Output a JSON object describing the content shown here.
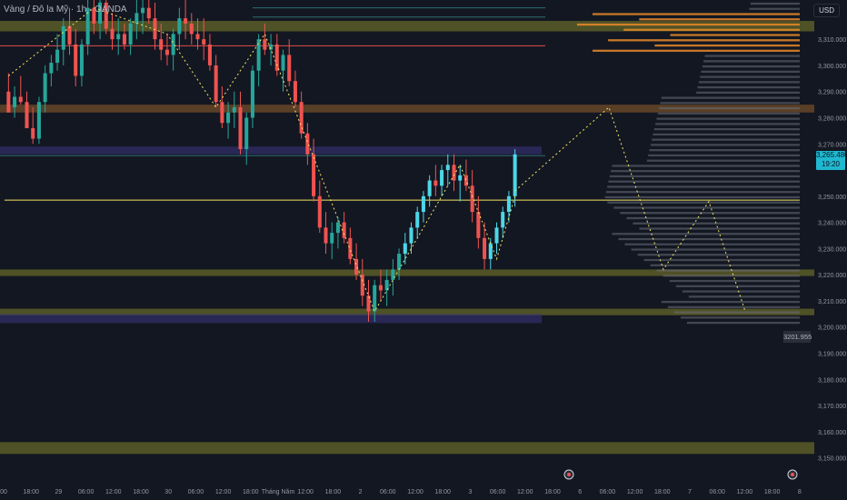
{
  "symbol_title": "Vàng / Đô la Mỹ · 1h · OANDA",
  "currency": "USD",
  "current_price": "3,265.480",
  "countdown": "19:20",
  "low_label": "3201.955",
  "y_axis_ticks": [
    "3,310.000",
    "3,300.000",
    "3,290.000",
    "3,280.000",
    "3,270.000",
    "3,250.000",
    "3,240.000",
    "3,230.000",
    "3,220.000",
    "3,210.000",
    "3,200.000",
    "3,190.000",
    "3,180.000",
    "3,170.000",
    "3,160.000",
    "3,150.000"
  ],
  "x_axis_ticks": [
    "00",
    "18:00",
    "29",
    "06:00",
    "12:00",
    "18:00",
    "30",
    "06:00",
    "12:00",
    "18:00",
    "Tháng Năm",
    "12:00",
    "18:00",
    "2",
    "06:00",
    "12:00",
    "18:00",
    "3",
    "06:00",
    "12:00",
    "18:00",
    "6",
    "06:00",
    "12:00",
    "18:00",
    "7",
    "06:00",
    "12:00",
    "18:00",
    "8"
  ],
  "colors": {
    "background": "#131722",
    "bull": "#26a69a",
    "bull_bright": "#4dd6e6",
    "bear": "#ef5350",
    "zone_olive": "#8b8b2a",
    "zone_brown": "#a0672a",
    "zone_purple": "#3a3580",
    "profile_orange": "#e8892a",
    "profile_grey": "#6b6f7a",
    "yellow_line": "#f5e663",
    "red_line": "#e04b4b"
  },
  "chart_data": {
    "type": "candlestick",
    "ylim": [
      3145,
      3325
    ],
    "hline_yellow": 3248.5,
    "hline_red": 3307.5,
    "hline_teal": [
      3318.5,
      3322,
      3265.5
    ],
    "zones": [
      {
        "color": "olive",
        "from": 3313,
        "to": 3317,
        "scope": "full"
      },
      {
        "color": "brown",
        "from": 3282,
        "to": 3285,
        "scope": "full"
      },
      {
        "color": "purple",
        "from": 3266,
        "to": 3269,
        "scope": "left"
      },
      {
        "color": "olive",
        "from": 3219.5,
        "to": 3222,
        "scope": "full"
      },
      {
        "color": "olive",
        "from": 3204.5,
        "to": 3207,
        "scope": "full"
      },
      {
        "color": "purple",
        "from": 3201.5,
        "to": 3205,
        "scope": "left"
      },
      {
        "color": "olive",
        "from": 3151.5,
        "to": 3156,
        "scope": "full"
      }
    ],
    "candles": [
      [
        3290,
        3297,
        3284,
        3282
      ],
      [
        3284,
        3292,
        3280,
        3288
      ],
      [
        3288,
        3296,
        3285,
        3286
      ],
      [
        3286,
        3290,
        3278,
        3276
      ],
      [
        3276,
        3284,
        3270,
        3272
      ],
      [
        3272,
        3288,
        3270,
        3286
      ],
      [
        3286,
        3300,
        3282,
        3297
      ],
      [
        3297,
        3304,
        3292,
        3301
      ],
      [
        3301,
        3312,
        3298,
        3306
      ],
      [
        3306,
        3318,
        3300,
        3315
      ],
      [
        3315,
        3322,
        3304,
        3308
      ],
      [
        3308,
        3314,
        3292,
        3296
      ],
      [
        3296,
        3310,
        3292,
        3308
      ],
      [
        3308,
        3325,
        3304,
        3322
      ],
      [
        3322,
        3325,
        3312,
        3316
      ],
      [
        3316,
        3325,
        3310,
        3324
      ],
      [
        3324,
        3325,
        3312,
        3314
      ],
      [
        3314,
        3320,
        3306,
        3310
      ],
      [
        3310,
        3318,
        3304,
        3312
      ],
      [
        3312,
        3316,
        3306,
        3308
      ],
      [
        3308,
        3318,
        3304,
        3316
      ],
      [
        3316,
        3325,
        3310,
        3320
      ],
      [
        3320,
        3325,
        3312,
        3322
      ],
      [
        3322,
        3325,
        3316,
        3318
      ],
      [
        3318,
        3324,
        3306,
        3310
      ],
      [
        3310,
        3316,
        3302,
        3306
      ],
      [
        3306,
        3312,
        3300,
        3304
      ],
      [
        3304,
        3314,
        3298,
        3312
      ],
      [
        3312,
        3322,
        3306,
        3318
      ],
      [
        3318,
        3325,
        3310,
        3316
      ],
      [
        3316,
        3320,
        3308,
        3312
      ],
      [
        3312,
        3318,
        3306,
        3310
      ],
      [
        3310,
        3318,
        3302,
        3308
      ],
      [
        3308,
        3312,
        3298,
        3300
      ],
      [
        3300,
        3304,
        3284,
        3286
      ],
      [
        3286,
        3292,
        3276,
        3278
      ],
      [
        3278,
        3286,
        3272,
        3282
      ],
      [
        3282,
        3290,
        3276,
        3284
      ],
      [
        3284,
        3290,
        3266,
        3268
      ],
      [
        3268,
        3282,
        3262,
        3280
      ],
      [
        3280,
        3300,
        3276,
        3298
      ],
      [
        3298,
        3312,
        3292,
        3310
      ],
      [
        3310,
        3316,
        3304,
        3306
      ],
      [
        3306,
        3312,
        3300,
        3308
      ],
      [
        3308,
        3312,
        3296,
        3298
      ],
      [
        3298,
        3306,
        3290,
        3304
      ],
      [
        3304,
        3310,
        3292,
        3294
      ],
      [
        3294,
        3298,
        3284,
        3286
      ],
      [
        3286,
        3290,
        3272,
        3274
      ],
      [
        3274,
        3278,
        3262,
        3266
      ],
      [
        3266,
        3272,
        3248,
        3250
      ],
      [
        3250,
        3256,
        3236,
        3238
      ],
      [
        3238,
        3244,
        3228,
        3232
      ],
      [
        3232,
        3240,
        3226,
        3236
      ],
      [
        3236,
        3242,
        3230,
        3240
      ],
      [
        3240,
        3244,
        3232,
        3234
      ],
      [
        3234,
        3238,
        3224,
        3226
      ],
      [
        3226,
        3232,
        3218,
        3220
      ],
      [
        3220,
        3226,
        3208,
        3212
      ],
      [
        3212,
        3218,
        3202,
        3206
      ],
      [
        3206,
        3218,
        3202,
        3216
      ],
      [
        3216,
        3222,
        3210,
        3214
      ],
      [
        3214,
        3222,
        3208,
        3218
      ],
      [
        3218,
        3226,
        3212,
        3222
      ],
      [
        3222,
        3230,
        3218,
        3228
      ],
      [
        3228,
        3236,
        3224,
        3232
      ],
      [
        3232,
        3240,
        3228,
        3238
      ],
      [
        3238,
        3246,
        3234,
        3244
      ],
      [
        3244,
        3252,
        3240,
        3250
      ],
      [
        3250,
        3258,
        3246,
        3256
      ],
      [
        3256,
        3262,
        3250,
        3254
      ],
      [
        3254,
        3262,
        3250,
        3260
      ],
      [
        3260,
        3266,
        3254,
        3262
      ],
      [
        3262,
        3266,
        3252,
        3256
      ],
      [
        3256,
        3262,
        3248,
        3258
      ],
      [
        3258,
        3264,
        3252,
        3254
      ],
      [
        3254,
        3260,
        3240,
        3244
      ],
      [
        3244,
        3250,
        3230,
        3234
      ],
      [
        3234,
        3240,
        3222,
        3226
      ],
      [
        3226,
        3234,
        3222,
        3232
      ],
      [
        3232,
        3240,
        3228,
        3238
      ],
      [
        3238,
        3246,
        3234,
        3244
      ],
      [
        3244,
        3252,
        3240,
        3250
      ],
      [
        3250,
        3268,
        3246,
        3266
      ]
    ],
    "projection": [
      [
        0.62,
        3252
      ],
      [
        0.67,
        3284
      ],
      [
        0.73,
        3222
      ],
      [
        0.78,
        3248
      ],
      [
        0.82,
        3206
      ]
    ]
  }
}
